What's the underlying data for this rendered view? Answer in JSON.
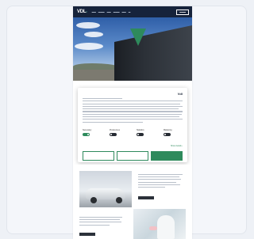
{
  "header": {
    "logo_main": "VDL",
    "logo_accent": "•",
    "nav_items": [
      "",
      "",
      "",
      "",
      "",
      ""
    ],
    "contact": ""
  },
  "hero": {},
  "cookie_dialog": {
    "brand": "Vdl",
    "title": "",
    "toggles": [
      {
        "label": "Necessary",
        "state": "on"
      },
      {
        "label": "Preferences",
        "state": "off"
      },
      {
        "label": "Statistics",
        "state": "off"
      },
      {
        "label": "Marketing",
        "state": "off"
      }
    ],
    "show_details": "Show details ›",
    "buttons": {
      "deny": "",
      "allow_selection": "",
      "allow_all": ""
    }
  },
  "colors": {
    "accent": "#2e8a5c",
    "nav_bg": "#16233b",
    "text_dark": "#1a2436"
  }
}
